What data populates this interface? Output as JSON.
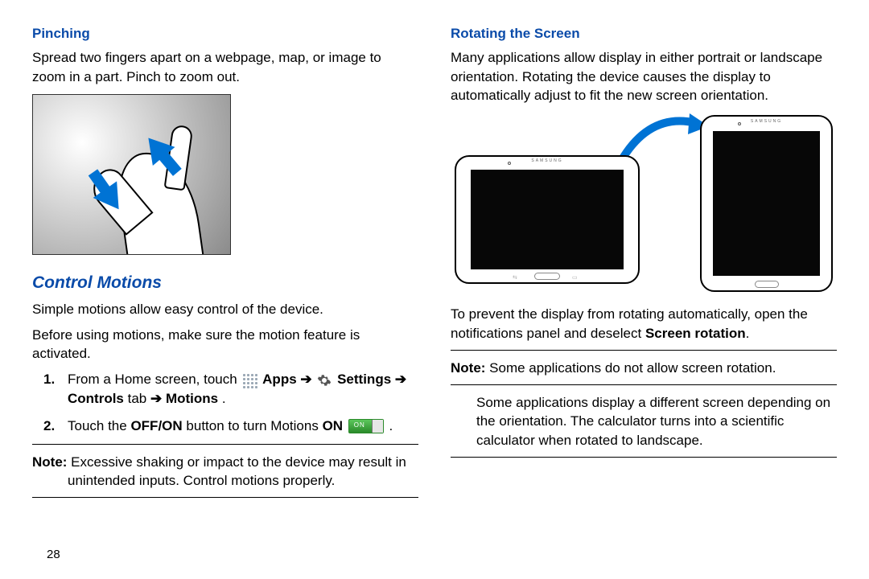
{
  "left": {
    "h_pinching": "Pinching",
    "pinching_body": "Spread two fingers apart on a webpage, map, or image to zoom in a part. Pinch to zoom out.",
    "h_control_motions": "Control Motions",
    "cm_p1": "Simple motions allow easy control of the device.",
    "cm_p2": "Before using motions, make sure the motion feature is activated.",
    "step1": {
      "lead": "From a Home screen, touch ",
      "apps": "Apps",
      "arrow": " ➔ ",
      "settings": "Settings",
      "arrow2": " ➔ ",
      "controls": "Controls",
      "tab_word": " tab ",
      "arrow3": "➔ ",
      "motions": "Motions",
      "period": "."
    },
    "step2": {
      "lead": "Touch the ",
      "offon": "OFF/ON",
      "mid": " button to turn Motions ",
      "on": "ON",
      "toggle_label": "ON",
      "period": " ."
    },
    "note_label": "Note:",
    "note_body": " Excessive shaking or impact to the device may result in unintended inputs. Control motions properly."
  },
  "right": {
    "h_rotating": "Rotating the Screen",
    "rot_body": "Many applications allow display in either portrait or landscape orientation. Rotating the device causes the display to automatically adjust to fit the new screen orientation.",
    "brand": "SAMSUNG",
    "rot_prevent_lead": "To prevent the display from rotating automatically, open the notifications panel and deselect ",
    "screen_rotation": "Screen rotation",
    "rot_prevent_period": ".",
    "note_label": "Note:",
    "note_body": " Some applications do not allow screen rotation.",
    "tail": "Some applications display a different screen depending on the orientation. The calculator turns into a scientific calculator when rotated to landscape."
  },
  "page_number": "28"
}
